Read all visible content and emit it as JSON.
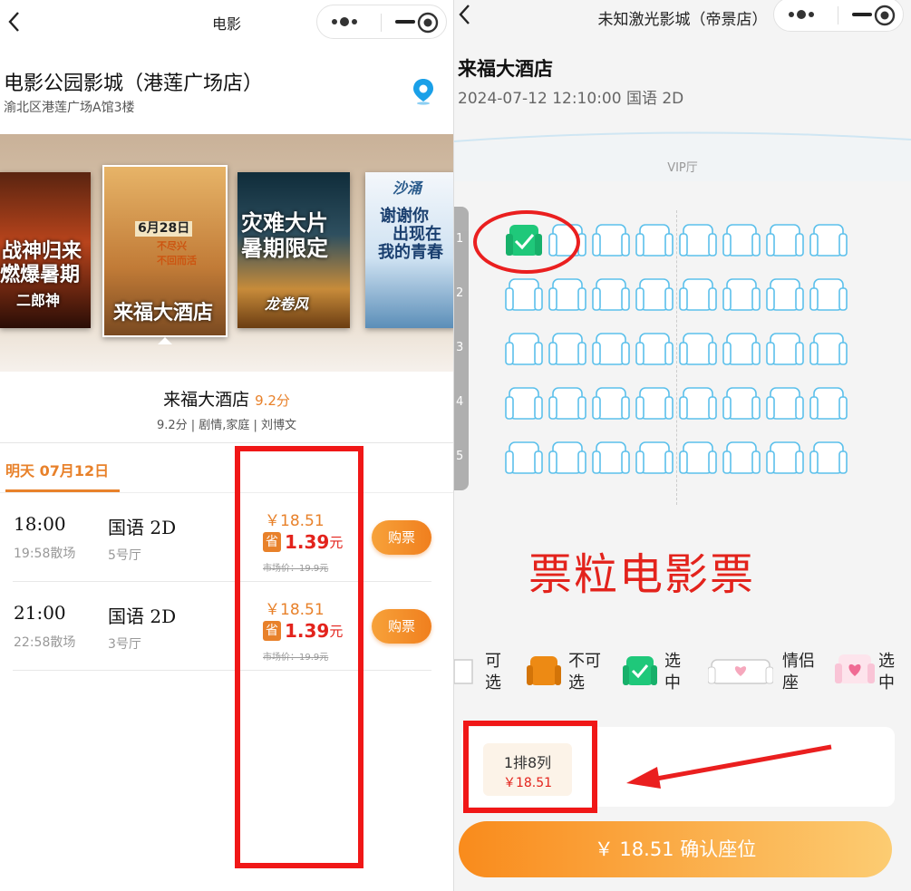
{
  "left": {
    "nav": {
      "title": "电影"
    },
    "cinema": {
      "name": "电影公园影城（港莲广场店）",
      "address": "渝北区港莲广场A馆3楼"
    },
    "posters": [
      {
        "name": "poster-erlangshen",
        "lines": [
          "战神归来",
          "燃爆暑期",
          "二郎神"
        ]
      },
      {
        "name": "poster-laifu",
        "lines": [
          "6月28日",
          "不尽兴",
          "不回而活",
          "来福大酒店"
        ]
      },
      {
        "name": "poster-longjuanfeng",
        "lines": [
          "灾难大片",
          "暑期限定",
          "龙卷风"
        ]
      },
      {
        "name": "poster-shayong",
        "lines": [
          "沙涌",
          "谢谢你",
          "出现在",
          "我的青春"
        ]
      }
    ],
    "movie": {
      "title": "来福大酒店",
      "score": "9.2分",
      "meta": "9.2分 | 剧情,家庭 | 刘博文"
    },
    "date_tab": "明天 07月12日",
    "showtimes": [
      {
        "time": "18:00",
        "end": "19:58散场",
        "lang": "国语 2D",
        "hall": "5号厅",
        "price": "￥18.51",
        "save_icon": "省",
        "save": "1.39",
        "unit": "元",
        "market": "市场价：19.9元",
        "buy": "购票"
      },
      {
        "time": "21:00",
        "end": "22:58散场",
        "lang": "国语 2D",
        "hall": "3号厅",
        "price": "￥18.51",
        "save_icon": "省",
        "save": "1.39",
        "unit": "元",
        "market": "市场价：19.9元",
        "buy": "购票"
      }
    ]
  },
  "right": {
    "nav": {
      "title": "未知激光影城（帝景店）"
    },
    "movie": "来福大酒店",
    "show": "2024-07-12 12:10:00 国语 2D",
    "hall_label": "VIP厅",
    "row_labels": [
      "1",
      "2",
      "3",
      "4",
      "5"
    ],
    "seats": {
      "rows": 5,
      "cols": 8,
      "selected": [
        [
          1,
          1
        ]
      ]
    },
    "watermark": "票粒电影票",
    "legend": [
      {
        "icon": "available-seat-icon",
        "text": "可\n选"
      },
      {
        "icon": "unavailable-seat-icon",
        "text": "不可\n选"
      },
      {
        "icon": "selected-seat-icon",
        "text": "选\n中"
      },
      {
        "icon": "couple-seat-icon",
        "text": "情侣\n座"
      },
      {
        "icon": "couple-selected-icon",
        "text": "选\n中"
      }
    ],
    "ticket": {
      "seat": "1排8列",
      "price": "￥18.51"
    },
    "confirm": "￥ 18.51 确认座位"
  },
  "colors": {
    "accent": "#e8812a",
    "red": "#e3231c",
    "seat": "#5bc0eb",
    "selected": "#1fc87a"
  }
}
